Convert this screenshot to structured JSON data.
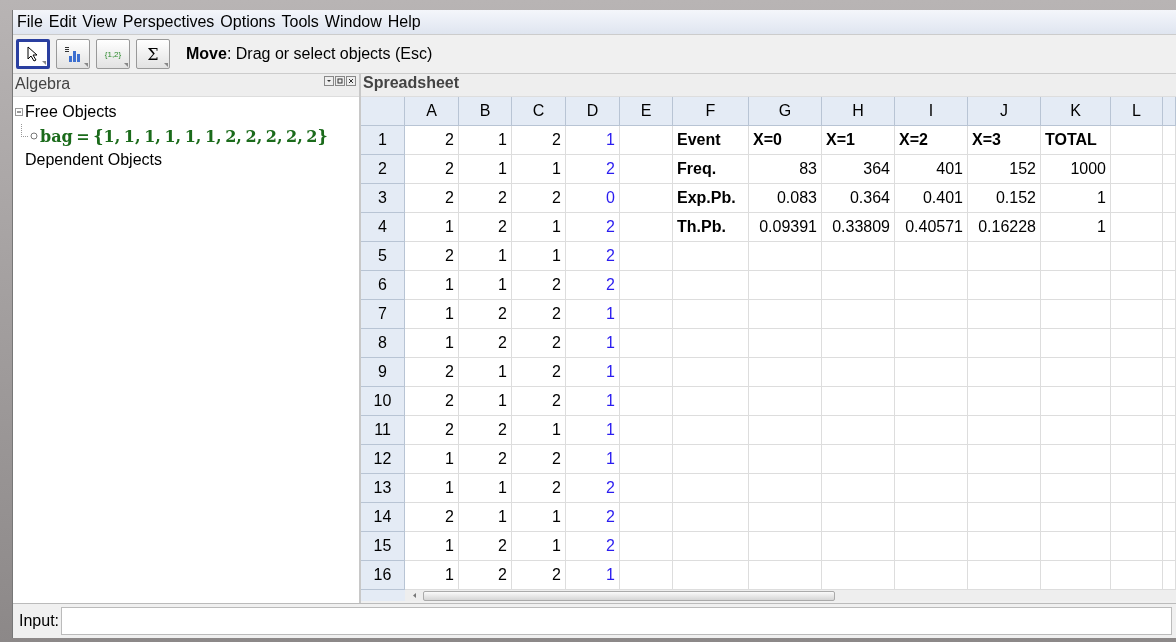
{
  "menu": [
    "File",
    "Edit",
    "View",
    "Perspectives",
    "Options",
    "Tools",
    "Window",
    "Help"
  ],
  "toolbar": {
    "tools": [
      {
        "kind": "move",
        "selected": true
      },
      {
        "kind": "chart",
        "selected": false
      },
      {
        "kind": "list",
        "label": "{1,2}",
        "selected": false
      },
      {
        "kind": "sum",
        "label": "Σ",
        "selected": false
      }
    ],
    "help": "**Move**: Drag or select objects (Esc)"
  },
  "algebra": {
    "title": "Algebra",
    "groups": [
      {
        "label": "Free Objects",
        "expanded": true,
        "children": [
          {
            "text": "bag = {1, 1, 1, 1, 1, 1, 2, 2, 2, 2, 2}",
            "shown": false
          }
        ]
      },
      {
        "label": "Dependent Objects",
        "expanded": false
      }
    ]
  },
  "spreadsheet": {
    "title": "Spreadsheet",
    "columns": [
      {
        "label": "A",
        "kind": "number"
      },
      {
        "label": "B",
        "kind": "number"
      },
      {
        "label": "C",
        "kind": "number"
      },
      {
        "label": "D",
        "kind": "computed"
      },
      {
        "label": "E",
        "kind": "number"
      },
      {
        "label": "F",
        "kind": "label"
      },
      {
        "label": "G",
        "kind": "value"
      },
      {
        "label": "H",
        "kind": "value"
      },
      {
        "label": "I",
        "kind": "value"
      },
      {
        "label": "J",
        "kind": "value"
      },
      {
        "label": "K",
        "kind": "value"
      },
      {
        "label": "L",
        "kind": "value"
      }
    ],
    "rows": [
      {
        "number": "1",
        "kind": "header",
        "cells": [
          "2",
          "1",
          "2",
          "1",
          null,
          "Event",
          "X=0",
          "X=1",
          "X=2",
          "X=3",
          "TOTAL"
        ]
      },
      {
        "number": "2",
        "kind": "data",
        "cells": [
          "2",
          "1",
          "1",
          "2",
          null,
          "Freq.",
          "83",
          "364",
          "401",
          "152",
          "1000"
        ]
      },
      {
        "number": "3",
        "kind": "data",
        "cells": [
          "2",
          "2",
          "2",
          "0",
          null,
          "Exp.Pb.",
          "0.083",
          "0.364",
          "0.401",
          "0.152",
          "1"
        ]
      },
      {
        "number": "4",
        "kind": "data",
        "cells": [
          "1",
          "2",
          "1",
          "2",
          null,
          "Th.Pb.",
          "0.09391",
          "0.33809",
          "0.40571",
          "0.16228",
          "1"
        ]
      },
      {
        "number": "5",
        "kind": "data",
        "cells": [
          "2",
          "1",
          "1",
          "2"
        ]
      },
      {
        "number": "6",
        "kind": "data",
        "cells": [
          "1",
          "1",
          "2",
          "2"
        ]
      },
      {
        "number": "7",
        "kind": "data",
        "cells": [
          "1",
          "2",
          "2",
          "1"
        ]
      },
      {
        "number": "8",
        "kind": "data",
        "cells": [
          "1",
          "2",
          "2",
          "1"
        ]
      },
      {
        "number": "9",
        "kind": "data",
        "cells": [
          "2",
          "1",
          "2",
          "1"
        ]
      },
      {
        "number": "10",
        "kind": "data",
        "cells": [
          "2",
          "1",
          "2",
          "1"
        ]
      },
      {
        "number": "11",
        "kind": "data",
        "cells": [
          "2",
          "2",
          "1",
          "1"
        ]
      },
      {
        "number": "12",
        "kind": "data",
        "cells": [
          "1",
          "2",
          "2",
          "1"
        ]
      },
      {
        "number": "13",
        "kind": "data",
        "cells": [
          "1",
          "1",
          "2",
          "2"
        ]
      },
      {
        "number": "14",
        "kind": "data",
        "cells": [
          "2",
          "1",
          "1",
          "2"
        ]
      },
      {
        "number": "15",
        "kind": "data",
        "cells": [
          "1",
          "2",
          "1",
          "2"
        ]
      },
      {
        "number": "16",
        "kind": "data",
        "cells": [
          "1",
          "2",
          "2",
          "1"
        ]
      }
    ]
  },
  "input": {
    "label": "Input:"
  }
}
